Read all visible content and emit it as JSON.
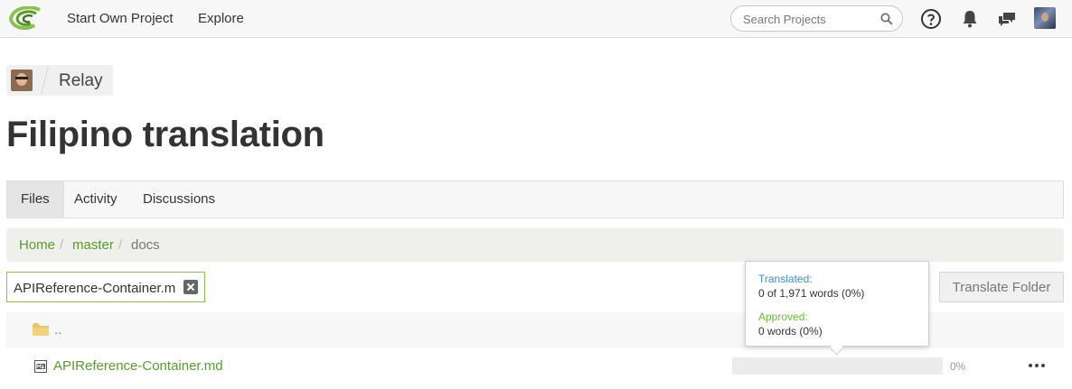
{
  "header": {
    "nav": {
      "start_project": "Start Own Project",
      "explore": "Explore"
    },
    "search": {
      "placeholder": "Search Projects",
      "value": ""
    },
    "icons": [
      "logo-icon",
      "search-icon",
      "help-icon",
      "bell-icon",
      "chat-icon",
      "user-avatar"
    ]
  },
  "project": {
    "name": "Relay"
  },
  "page": {
    "title": "Filipino translation"
  },
  "tabs": [
    {
      "label": "Files",
      "active": true
    },
    {
      "label": "Activity",
      "active": false
    },
    {
      "label": "Discussions",
      "active": false
    }
  ],
  "breadcrumb": {
    "items": [
      "Home",
      "master",
      "docs"
    ],
    "separator": "/"
  },
  "filter": {
    "value": "APIReference-Container.m"
  },
  "actions": {
    "translate_folder": "Translate Folder"
  },
  "files": {
    "up_label": "..",
    "rows": [
      {
        "name": "APIReference-Container.md",
        "percent": "0%",
        "progress": 0
      }
    ]
  },
  "tooltip": {
    "translated_label": "Translated:",
    "translated_value": "0 of 1,971 words (0%)",
    "approved_label": "Approved:",
    "approved_value": "0 words (0%)"
  },
  "colors": {
    "accent_green": "#5a9a2e",
    "translated_blue": "#3b8fd6",
    "approved_green": "#6cb83a"
  }
}
